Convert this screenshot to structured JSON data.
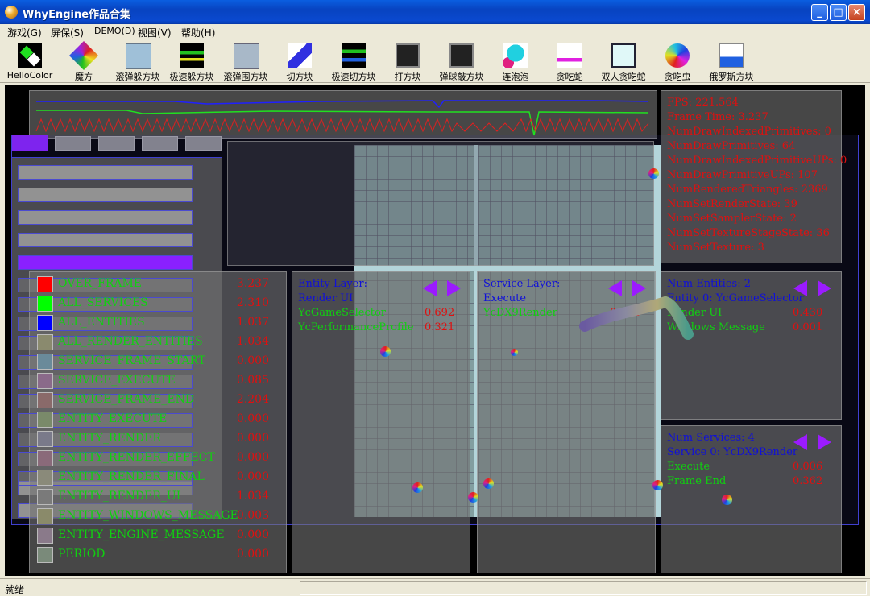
{
  "window": {
    "title": "WhyEngine作品合集",
    "minimize": "_",
    "maximize": "□",
    "close": "×"
  },
  "menu": [
    "游戏(G)",
    "屏保(S)",
    "DEMO(D)",
    "视图(V)",
    "帮助(H)"
  ],
  "toolbar": [
    {
      "label": "HelloColor",
      "icon": "hellocolor-icon"
    },
    {
      "label": "魔方",
      "icon": "rubiks-cube-icon"
    },
    {
      "label": "滚弹躲方块",
      "icon": "dodge-blocks-icon"
    },
    {
      "label": "极速躲方块",
      "icon": "speed-dodge-icon"
    },
    {
      "label": "滚弹围方块",
      "icon": "surround-blocks-icon"
    },
    {
      "label": "切方块",
      "icon": "cut-blocks-icon"
    },
    {
      "label": "极速切方块",
      "icon": "speed-cut-icon"
    },
    {
      "label": "打方块",
      "icon": "hit-blocks-icon"
    },
    {
      "label": "弹球敲方块",
      "icon": "breakout-icon"
    },
    {
      "label": "连泡泡",
      "icon": "bubbles-icon"
    },
    {
      "label": "贪吃蛇",
      "icon": "snake-icon"
    },
    {
      "label": "双人贪吃蛇",
      "icon": "two-player-snake-icon"
    },
    {
      "label": "贪吃虫",
      "icon": "worm-icon"
    },
    {
      "label": "俄罗斯方块",
      "icon": "tetris-icon"
    }
  ],
  "stats": [
    "FPS: 221.564",
    "Frame Time: 3.237",
    "NumDrawIndexedPrimitives: 0",
    "NumDrawPrimitives: 64",
    "NumDrawIndexedPrimitiveUPs: 0",
    "NumDrawPrimitiveUPs: 107",
    "NumRenderedTriangles: 2369",
    "NumSetRenderState: 39",
    "NumSetSamplerState: 2",
    "NumSetTextureStageState: 36",
    "NumSetTexture: 3"
  ],
  "profile": [
    {
      "name": "OVER_FRAME",
      "value": "3.237",
      "color": "#ff0000"
    },
    {
      "name": "ALL_SERVICES",
      "value": "2.310",
      "color": "#00ff00"
    },
    {
      "name": "ALL_ENTITIES",
      "value": "1.037",
      "color": "#0000ff"
    },
    {
      "name": "ALL_RENDER_ENTITIES",
      "value": "1.034",
      "color": "#8a8a6e"
    },
    {
      "name": "SERVICE_FRAME_START",
      "value": "0.000",
      "color": "#6a8a9a"
    },
    {
      "name": "SERVICE_EXECUTE",
      "value": "0.085",
      "color": "#8a6a8a"
    },
    {
      "name": "SERVICE_FRAME_END",
      "value": "2.204",
      "color": "#8a6a6a"
    },
    {
      "name": "ENTITY_EXECUTE",
      "value": "0.000",
      "color": "#7a8a6a"
    },
    {
      "name": "ENTITY_RENDER",
      "value": "0.000",
      "color": "#7a7a8a"
    },
    {
      "name": "ENTITY_RENDER_EFFECT",
      "value": "0.000",
      "color": "#8a6a7a"
    },
    {
      "name": "ENTITY_RENDER_FINAL",
      "value": "0.000",
      "color": "#8a8a7a"
    },
    {
      "name": "ENTITY_RENDER_UI",
      "value": "1.034",
      "color": "#7a7a7a"
    },
    {
      "name": "ENTITY_WINDOWS_MESSAGE",
      "value": "0.003",
      "color": "#8a8a6a"
    },
    {
      "name": "ENTITY_ENGINE_MESSAGE",
      "value": "0.000",
      "color": "#8a7a8a"
    },
    {
      "name": "PERIOD",
      "value": "0.000",
      "color": "#7a8a7a"
    }
  ],
  "entity_layer": {
    "title": "Entity Layer:",
    "sub": "Render UI",
    "rows": [
      {
        "name": "YcGameSelector",
        "value": "0.692"
      },
      {
        "name": "YcPerformanceProfile",
        "value": "0.321"
      }
    ]
  },
  "service_layer": {
    "title": "Service Layer:",
    "sub": "Execute",
    "rows": [
      {
        "name": "YcDX9Render",
        "value": "0.004"
      }
    ]
  },
  "entities": {
    "title": "Num Entities: 2",
    "sub": "Entity 0: YcGameSelector",
    "rows": [
      {
        "name": "Render UI",
        "value": "0.430"
      },
      {
        "name": "Windows Message",
        "value": "0.001"
      }
    ]
  },
  "services": {
    "title": "Num Services: 4",
    "sub": "Service 0: YcDX9Render",
    "rows": [
      {
        "name": "Execute",
        "value": "0.006"
      },
      {
        "name": "Frame End",
        "value": "0.362"
      }
    ]
  },
  "status": {
    "text": "就绪"
  }
}
